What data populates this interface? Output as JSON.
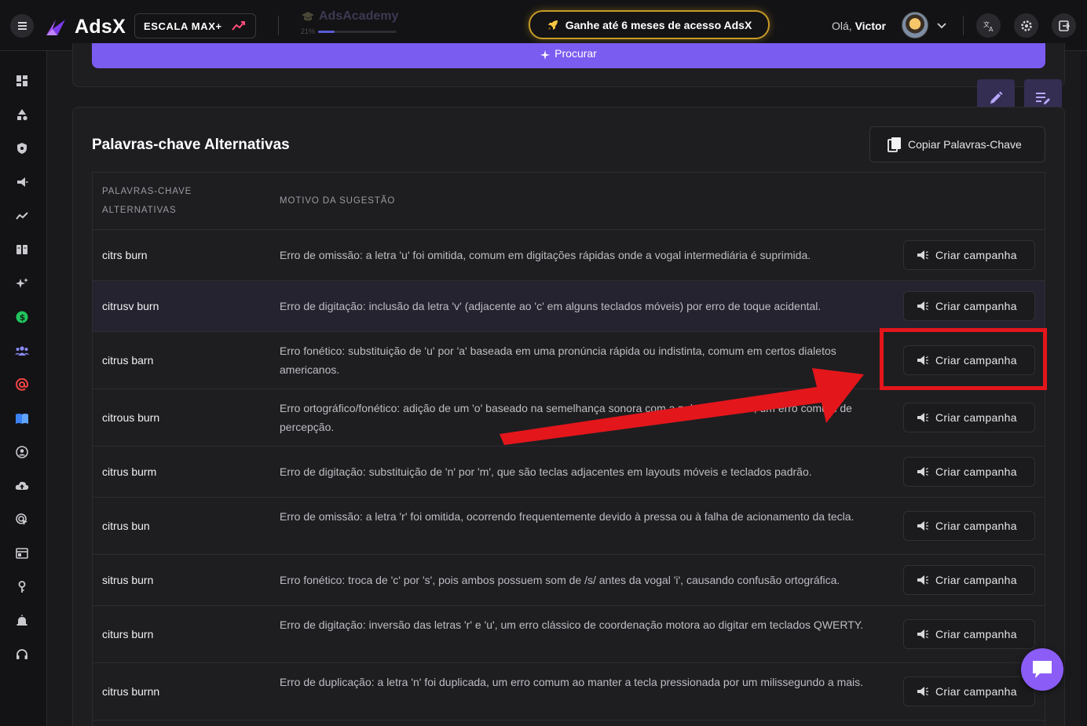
{
  "topbar": {
    "brand": "AdsX",
    "plan_badge": "ESCALA MAX+",
    "academy_title": "AdsAcademy",
    "academy_progress_label": "21%",
    "academy_progress": 0.21,
    "promo_text": "Ganhe até 6 meses de acesso AdsX",
    "greeting_prefix": "Olá,",
    "user_name": "Victor"
  },
  "search": {
    "button_label": "Procurar"
  },
  "section": {
    "title": "Palavras-chave Alternativas",
    "copy_button": "Copiar Palavras-Chave"
  },
  "table": {
    "headers": {
      "keyword_line1": "PALAVRAS-CHAVE",
      "keyword_line2": "ALTERNATIVAS",
      "reason": "MOTIVO DA SUGESTÃO"
    },
    "action_label": "Criar campanha",
    "rows": [
      {
        "keyword": "citrs burn",
        "reason": "Erro de omissão: a letra 'u' foi omitida, comum em digitações rápidas onde a vogal intermediária é suprimida."
      },
      {
        "keyword": "citrusv burn",
        "reason": "Erro de digitação: inclusão da letra 'v' (adjacente ao 'c' em alguns teclados móveis) por erro de toque acidental."
      },
      {
        "keyword": "citrus barn",
        "reason": "Erro fonético: substituição de 'u' por 'a' baseada em uma pronúncia rápida ou indistinta, comum em certos dialetos americanos."
      },
      {
        "keyword": "citrous burn",
        "reason": "Erro ortográfico/fonético: adição de um 'o' baseado na semelhança sonora com a palavra 'citrous', um erro comum de percepção."
      },
      {
        "keyword": "citrus burm",
        "reason": "Erro de digitação: substituição de 'n' por 'm', que são teclas adjacentes em layouts móveis e teclados padrão."
      },
      {
        "keyword": "citrus bun",
        "reason": "Erro de omissão: a letra 'r' foi omitida, ocorrendo frequentemente devido à pressa ou à falha de acionamento da tecla."
      },
      {
        "keyword": "sitrus burn",
        "reason": "Erro fonético: troca de 'c' por 's', pois ambos possuem som de /s/ antes da vogal 'i', causando confusão ortográfica."
      },
      {
        "keyword": "citurs burn",
        "reason": "Erro de digitação: inversão das letras 'r' e 'u', um erro clássico de coordenação motora ao digitar em teclados QWERTY."
      },
      {
        "keyword": "citrus burnn",
        "reason": "Erro de duplicação: a letra 'n' foi duplicada, um erro comum ao manter a tecla pressionada por um milissegundo a mais."
      }
    ]
  },
  "colors": {
    "accent": "#7b5cf0",
    "highlight": "#e3161b",
    "promo_border": "#c69a26"
  },
  "icons": [
    "menu-icon",
    "adsx-logo-icon",
    "trend-up-icon",
    "graduation-cap-icon",
    "rocket-icon",
    "chevron-down-icon",
    "translate-icon",
    "settings-icon",
    "logout-icon",
    "sparkle-icon",
    "copy-icon",
    "megaphone-icon",
    "pencil-icon",
    "edit-list-icon",
    "chat-icon"
  ]
}
